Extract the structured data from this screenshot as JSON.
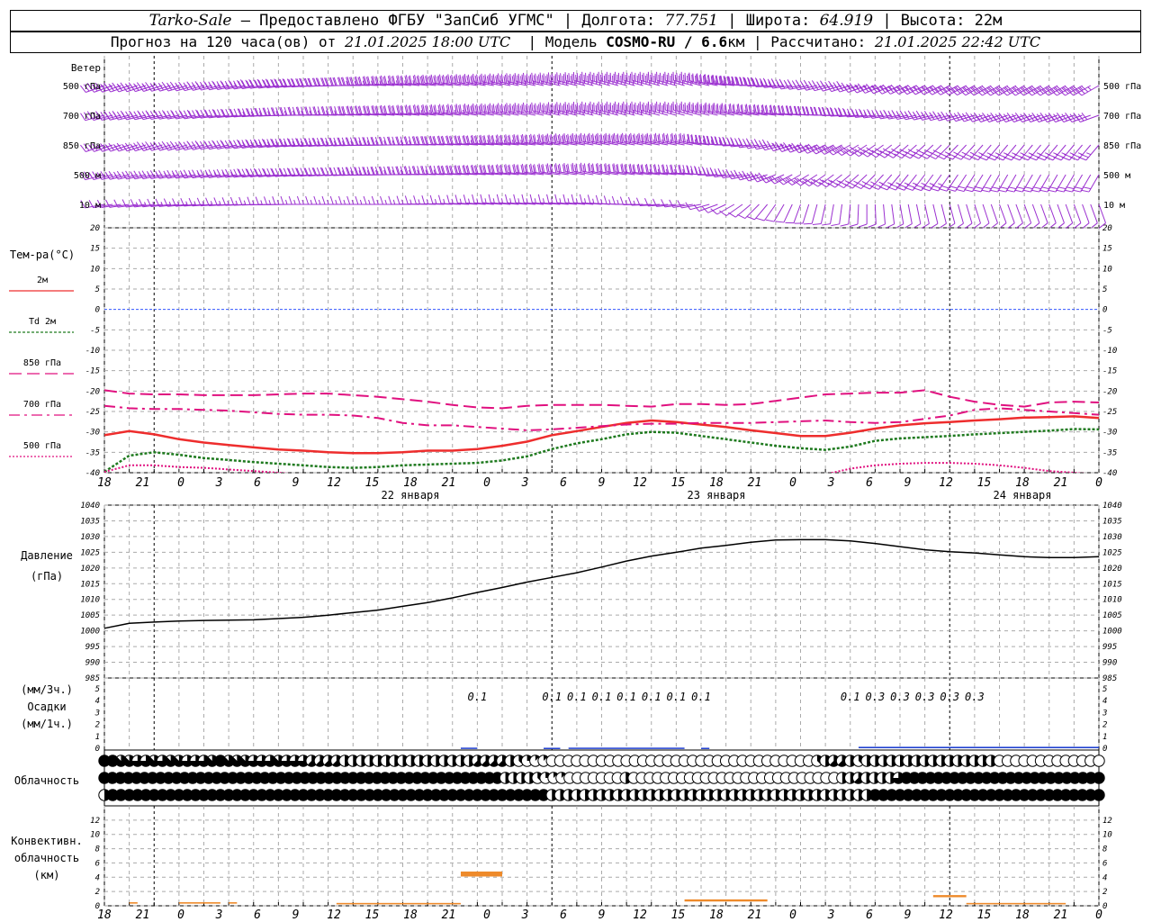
{
  "header": {
    "station": "Tarko-Sale",
    "provider": " – Предоставлено ФГБУ \"ЗапСиб УГМС\" | Долгота: ",
    "lon": "77.751",
    "lat_label": " | Широта: ",
    "lat": "64.919",
    "alt_label": " | Высота: 22м",
    "forecast_label": "Прогноз на 120 часа(ов) от ",
    "start": "21.01.2025 18:00 UTC",
    "model_label": "  | Модель ",
    "model": "COSMO-RU / 6.6",
    "model_unit": "км | Рассчитано: ",
    "computed": "21.01.2025 22:42 UTC"
  },
  "panel_labels": {
    "wind": "Ветер",
    "wind_levels": [
      "500 гПа",
      "700 гПа",
      "850 гПа",
      "500  м",
      "10   м"
    ],
    "temp_title": "Тем-ра(°C)",
    "temp_legend": [
      "2м",
      "Td  2м",
      "850 гПа",
      "700 гПа",
      "500 гПа"
    ],
    "pressure": [
      "Давление",
      "(гПа)"
    ],
    "precip": [
      "(мм/3ч.)",
      "Осадки",
      "(мм/1ч.)"
    ],
    "cloud": "Облачность",
    "conv": [
      "Конвективн.",
      "облачность",
      "(км)"
    ]
  },
  "x_ticks": [
    "18",
    "21",
    "0",
    "3",
    "6",
    "9",
    "12",
    "15",
    "18",
    "21",
    "0",
    "3",
    "6",
    "9",
    "12",
    "15",
    "18",
    "21",
    "0",
    "3",
    "6",
    "9",
    "12",
    "15",
    "18",
    "21",
    "0"
  ],
  "day_labels": [
    "22 января",
    "23 января",
    "24 января"
  ],
  "colors": {
    "wind": "#9b30d0",
    "t2m": "#ee2d2d",
    "td2m": "#1f7a1f",
    "t850": "#e0107f",
    "zero_line": "#3355ff",
    "pressure": "#000000",
    "precip": "#2040d0",
    "conv": "#ee8a2a",
    "grid": "#aaaaaa"
  },
  "chart_data": [
    {
      "type": "line",
      "title": "Тем-ра(°C)",
      "x_hours": [
        0,
        3,
        6,
        9,
        12,
        15,
        18,
        21,
        24,
        27,
        30,
        33,
        36,
        39,
        42,
        45,
        48,
        51,
        54,
        57,
        60,
        63,
        66,
        69,
        72,
        75,
        78,
        81,
        84,
        87,
        90,
        93,
        96,
        99,
        102,
        105,
        108,
        111,
        114,
        117,
        120
      ],
      "ylim": [
        -40,
        20
      ],
      "yticks": [
        20,
        15,
        10,
        5,
        0,
        -5,
        -10,
        -15,
        -20,
        -25,
        -30,
        -35,
        -40
      ],
      "series": [
        {
          "name": "2м",
          "style": "solid",
          "values": [
            -30.8,
            -29.8,
            -30.6,
            -31.8,
            -32.6,
            -33.2,
            -33.8,
            -34.3,
            -34.6,
            -35,
            -35.2,
            -35.2,
            -35,
            -34.6,
            -34.6,
            -34.2,
            -33.4,
            -32.4,
            -30.8,
            -29.8,
            -28.8,
            -27.8,
            -27.2,
            -27.6,
            -28.2,
            -28.8,
            -29.6,
            -30.3,
            -31,
            -31,
            -30.2,
            -29.2,
            -28.4,
            -27.9,
            -27.6,
            -27.2,
            -26.9,
            -26.5,
            -26.4,
            -26.2,
            -26.6
          ]
        },
        {
          "name": "Td  2м",
          "style": "dotted",
          "values": [
            -39.8,
            -35.8,
            -35,
            -35.6,
            -36.4,
            -36.9,
            -37.4,
            -37.8,
            -38.2,
            -38.6,
            -38.8,
            -38.6,
            -38.2,
            -38,
            -37.8,
            -37.6,
            -37,
            -36,
            -34.2,
            -32.8,
            -31.8,
            -30.6,
            -30,
            -30.2,
            -31,
            -31.8,
            -32.6,
            -33.4,
            -34,
            -34.4,
            -33.6,
            -32.2,
            -31.6,
            -31.3,
            -31,
            -30.6,
            -30.3,
            -30,
            -29.7,
            -29.3,
            -29.4
          ]
        },
        {
          "name": "850 гПа",
          "style": "dashed",
          "values": [
            -19.8,
            -20.6,
            -20.8,
            -20.8,
            -21,
            -21,
            -21,
            -20.8,
            -20.6,
            -20.6,
            -21,
            -21.4,
            -22,
            -22.6,
            -23.4,
            -24,
            -24.2,
            -23.6,
            -23.4,
            -23.4,
            -23.4,
            -23.6,
            -23.8,
            -23.2,
            -23.2,
            -23.4,
            -23.2,
            -22.4,
            -21.6,
            -20.8,
            -20.6,
            -20.4,
            -20.4,
            -19.8,
            -21.4,
            -22.6,
            -23.4,
            -23.8,
            -22.8,
            -22.6,
            -22.8
          ]
        },
        {
          "name": "700 гПа",
          "style": "dashdot",
          "values": [
            -23.6,
            -24.2,
            -24.4,
            -24.4,
            -24.6,
            -24.8,
            -25.2,
            -25.6,
            -25.8,
            -25.8,
            -26,
            -26.6,
            -27.8,
            -28.4,
            -28.4,
            -28.8,
            -29.2,
            -29.6,
            -29.4,
            -29,
            -28.6,
            -28.2,
            -28,
            -28,
            -27.8,
            -27.8,
            -27.8,
            -27.6,
            -27.4,
            -27.2,
            -27.6,
            -27.8,
            -27.6,
            -26.8,
            -26,
            -24.6,
            -24.2,
            -24.6,
            -25,
            -25.4,
            -25.8
          ]
        },
        {
          "name": "500 гПа",
          "style": "dotted",
          "values": [
            -39.8,
            -38.2,
            -38.2,
            -38.6,
            -38.8,
            -39.2,
            -39.6,
            -40,
            -40.5,
            -41,
            -41.5,
            -42,
            -42.5,
            -43,
            -43.5,
            -44,
            -44.5,
            -45,
            -45.5,
            -46,
            -46,
            -45.8,
            -45.5,
            -45.2,
            -45,
            -44.5,
            -43.5,
            -42.5,
            -41.5,
            -40.4,
            -39,
            -38.2,
            -37.8,
            -37.6,
            -37.6,
            -37.8,
            -38.2,
            -38.8,
            -39.6,
            -40,
            -40.5
          ]
        }
      ]
    },
    {
      "type": "line",
      "title": "Давление",
      "ylabel": "(гПа)",
      "x_hours": [
        0,
        3,
        6,
        9,
        12,
        15,
        18,
        21,
        24,
        27,
        30,
        33,
        36,
        39,
        42,
        45,
        48,
        51,
        54,
        57,
        60,
        63,
        66,
        69,
        72,
        75,
        78,
        81,
        84,
        87,
        90,
        93,
        96,
        99,
        102,
        105,
        108,
        111,
        114,
        117,
        120
      ],
      "ylim": [
        985,
        1040
      ],
      "yticks": [
        1040,
        1035,
        1030,
        1025,
        1020,
        1015,
        1010,
        1005,
        1000,
        995,
        990,
        985
      ],
      "series": [
        {
          "name": "Давление",
          "values": [
            1000.8,
            1002.4,
            1002.8,
            1003.1,
            1003.3,
            1003.4,
            1003.5,
            1003.9,
            1004.3,
            1005,
            1005.8,
            1006.6,
            1007.8,
            1009,
            1010.5,
            1012.2,
            1013.8,
            1015.5,
            1017,
            1018.5,
            1020.3,
            1022.2,
            1023.8,
            1025,
            1026.3,
            1027.2,
            1028.2,
            1028.9,
            1029,
            1029,
            1028.6,
            1027.8,
            1026.8,
            1025.8,
            1025.2,
            1024.8,
            1024.2,
            1023.6,
            1023.3,
            1023.3,
            1023.6
          ]
        }
      ]
    },
    {
      "type": "bar",
      "title": "Осадки",
      "ylabel": "(мм/3ч.) (мм/1ч.)",
      "ylim": [
        0,
        5
      ],
      "yticks": [
        5,
        4,
        3,
        2,
        1,
        0
      ],
      "labels_3h": [
        {
          "hour": 45,
          "value": "0.1"
        },
        {
          "hour": 54,
          "value": "0.1"
        },
        {
          "hour": 57,
          "value": "0.1"
        },
        {
          "hour": 60,
          "value": "0.1"
        },
        {
          "hour": 63,
          "value": "0.1"
        },
        {
          "hour": 66,
          "value": "0.1"
        },
        {
          "hour": 69,
          "value": "0.1"
        },
        {
          "hour": 72,
          "value": "0.1"
        },
        {
          "hour": 90,
          "value": "0.1"
        },
        {
          "hour": 93,
          "value": "0.3"
        },
        {
          "hour": 96,
          "value": "0.3"
        },
        {
          "hour": 99,
          "value": "0.3"
        },
        {
          "hour": 102,
          "value": "0.3"
        },
        {
          "hour": 105,
          "value": "0.3"
        }
      ],
      "hourly": [
        {
          "from": 43,
          "to": 45,
          "value": 0.05
        },
        {
          "from": 53,
          "to": 55,
          "value": 0.04
        },
        {
          "from": 56,
          "to": 70,
          "value": 0.05
        },
        {
          "from": 72,
          "to": 73,
          "value": 0.04
        },
        {
          "from": 91,
          "to": 120,
          "value": 0.12
        }
      ]
    },
    {
      "type": "table",
      "title": "Облачность",
      "note": "cloud cover in oktas per hour; rows: upper, middle, lower",
      "rows": [
        [
          8,
          8,
          7,
          7,
          6,
          6,
          7,
          6,
          7,
          7,
          6,
          6,
          6,
          7,
          8,
          7,
          7,
          7,
          6,
          6,
          6,
          7,
          6,
          6,
          6,
          5,
          5,
          5,
          5,
          4,
          4,
          4,
          4,
          4,
          4,
          4,
          4,
          4,
          4,
          4,
          4,
          4,
          4,
          4,
          4,
          5,
          5,
          5,
          5,
          4,
          3,
          2,
          1,
          1,
          0,
          0,
          0,
          0,
          0,
          0,
          0,
          0,
          0,
          0,
          0,
          0,
          0,
          0,
          0,
          0,
          0,
          0,
          0,
          0,
          0,
          0,
          0,
          0,
          0,
          0,
          0,
          0,
          0,
          0,
          0,
          0,
          3,
          4,
          5,
          5,
          4,
          3,
          4,
          4,
          4,
          4,
          4,
          4,
          4,
          4,
          4,
          4,
          4,
          4,
          4,
          4,
          4,
          4,
          0,
          0,
          0,
          0,
          0,
          0,
          0,
          0,
          0,
          0,
          0,
          0,
          0
        ],
        [
          8,
          8,
          8,
          8,
          8,
          8,
          8,
          8,
          8,
          8,
          8,
          8,
          8,
          8,
          8,
          8,
          8,
          8,
          8,
          8,
          8,
          8,
          8,
          8,
          8,
          8,
          8,
          8,
          8,
          8,
          8,
          8,
          8,
          8,
          8,
          8,
          8,
          8,
          8,
          8,
          8,
          8,
          8,
          8,
          8,
          8,
          8,
          8,
          8,
          8,
          4,
          4,
          4,
          4,
          3,
          2,
          1,
          1,
          0,
          0,
          0,
          0,
          0,
          0,
          0,
          4,
          0,
          0,
          0,
          0,
          0,
          0,
          0,
          0,
          0,
          0,
          0,
          0,
          0,
          0,
          0,
          0,
          0,
          0,
          0,
          0,
          0,
          0,
          0,
          0,
          0,
          0,
          4,
          4,
          5,
          4,
          4,
          4,
          4,
          6,
          8,
          8,
          8,
          8,
          8,
          8,
          8,
          8,
          8,
          8,
          8,
          8,
          8,
          8,
          8,
          8,
          8,
          8,
          8,
          8,
          8,
          8,
          8,
          8,
          8
        ],
        [
          4,
          8,
          8,
          8,
          8,
          8,
          8,
          8,
          8,
          8,
          8,
          8,
          8,
          8,
          8,
          8,
          8,
          8,
          8,
          8,
          8,
          8,
          8,
          8,
          8,
          8,
          8,
          8,
          8,
          8,
          8,
          8,
          8,
          8,
          8,
          8,
          8,
          8,
          8,
          8,
          8,
          8,
          8,
          8,
          8,
          8,
          8,
          8,
          8,
          8,
          8,
          8,
          8,
          8,
          4,
          4,
          4,
          4,
          4,
          4,
          4,
          4,
          4,
          4,
          4,
          4,
          4,
          4,
          4,
          4,
          4,
          4,
          4,
          4,
          4,
          4,
          4,
          4,
          4,
          4,
          4,
          4,
          4,
          4,
          4,
          4,
          4,
          4,
          4,
          4,
          4,
          4,
          4,
          8,
          8,
          8,
          8,
          8,
          8,
          8,
          8,
          8,
          8,
          8,
          8,
          8,
          8,
          8,
          8,
          8,
          8,
          8,
          8,
          8,
          8,
          8,
          8,
          8,
          8,
          8,
          8
        ]
      ]
    },
    {
      "type": "bar",
      "title": "Конвективн. облачность",
      "ylabel": "(км)",
      "ylim": [
        0,
        14
      ],
      "yticks": [
        12,
        10,
        8,
        6,
        4,
        2,
        0
      ],
      "segments": [
        {
          "from": 3,
          "to": 4,
          "bottom": 0.3,
          "top": 0.5
        },
        {
          "from": 9,
          "to": 14,
          "bottom": 0.3,
          "top": 0.5
        },
        {
          "from": 15,
          "to": 16,
          "bottom": 0.3,
          "top": 0.5
        },
        {
          "from": 28,
          "to": 43,
          "bottom": 0.2,
          "top": 0.4
        },
        {
          "from": 43,
          "to": 48,
          "bottom": 4.1,
          "top": 4.8
        },
        {
          "from": 70,
          "to": 80,
          "bottom": 0.6,
          "top": 0.9
        },
        {
          "from": 100,
          "to": 104,
          "bottom": 1.2,
          "top": 1.5
        },
        {
          "from": 104,
          "to": 116,
          "bottom": 0.2,
          "top": 0.4
        }
      ]
    },
    {
      "type": "scatter",
      "title": "Ветер",
      "note": "wind barbs by level; speed in knots, direction in degrees (from)",
      "levels": [
        "500 гПа",
        "700 гПа",
        "850 гПа",
        "500  м",
        "10   м"
      ],
      "key_hours": [
        0,
        12,
        24,
        36,
        48,
        60,
        72,
        84,
        96,
        108,
        120
      ],
      "direction": [
        [
          250,
          255,
          265,
          275,
          280,
          285,
          285,
          260,
          245,
          240,
          240
        ],
        [
          255,
          260,
          270,
          275,
          280,
          285,
          285,
          275,
          260,
          250,
          250
        ],
        [
          250,
          255,
          265,
          270,
          275,
          280,
          280,
          250,
          230,
          220,
          220
        ],
        [
          255,
          260,
          265,
          270,
          275,
          280,
          275,
          240,
          220,
          210,
          210
        ],
        [
          260,
          265,
          270,
          270,
          275,
          275,
          260,
          200,
          170,
          160,
          160
        ]
      ],
      "speed": [
        [
          35,
          35,
          40,
          45,
          55,
          65,
          60,
          40,
          35,
          35,
          35
        ],
        [
          30,
          30,
          35,
          40,
          50,
          55,
          50,
          40,
          35,
          30,
          30
        ],
        [
          25,
          30,
          35,
          35,
          45,
          50,
          45,
          35,
          30,
          25,
          25
        ],
        [
          25,
          25,
          30,
          35,
          40,
          40,
          35,
          25,
          25,
          20,
          20
        ],
        [
          10,
          15,
          15,
          15,
          15,
          15,
          10,
          10,
          10,
          10,
          10
        ]
      ]
    }
  ]
}
